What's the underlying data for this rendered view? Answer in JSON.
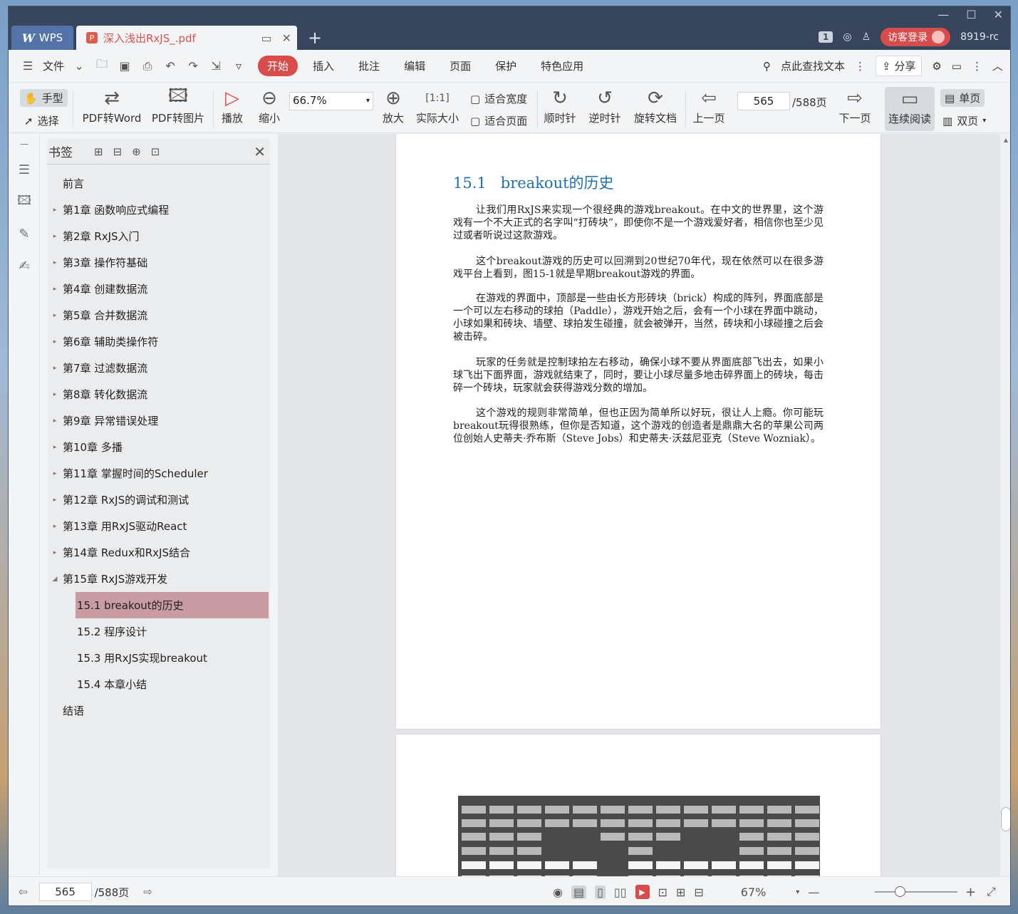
{
  "titlebar": {
    "app_tab": "WPS",
    "doc_tab": "深入浅出RxJS_.pdf",
    "badge": "1",
    "login": "访客登录",
    "user": "8919-rc"
  },
  "menubar": {
    "file": "文件",
    "tabs": [
      "开始",
      "插入",
      "批注",
      "编辑",
      "页面",
      "保护",
      "特色应用"
    ],
    "active_tab": "开始",
    "search": "点此查找文本",
    "share": "分享"
  },
  "toolbar": {
    "hand": "手型",
    "select": "选择",
    "pdf_to_word": "PDF转Word",
    "pdf_to_image": "PDF转图片",
    "play": "播放",
    "zoom_out": "缩小",
    "zoom_value": "66.7%",
    "zoom_in": "放大",
    "actual_size": "实际大小",
    "fit_width": "适合宽度",
    "fit_page": "适合页面",
    "clockwise": "顺时针",
    "counterclockwise": "逆时针",
    "rotate_doc": "旋转文档",
    "prev_page": "上一页",
    "page_value": "565",
    "page_total": "/588页",
    "next_page": "下一页",
    "continuous": "连续阅读",
    "single": "单页",
    "double": "双页"
  },
  "bookmarks": {
    "title": "书签",
    "items": [
      {
        "label": "前言",
        "arrow": ""
      },
      {
        "label": "第1章 函数响应式编程",
        "arrow": "▸"
      },
      {
        "label": "第2章 RxJS入门",
        "arrow": "▸"
      },
      {
        "label": "第3章 操作符基础",
        "arrow": "▸"
      },
      {
        "label": "第4章 创建数据流",
        "arrow": "▸"
      },
      {
        "label": "第5章 合并数据流",
        "arrow": "▸"
      },
      {
        "label": "第6章 辅助类操作符",
        "arrow": "▸"
      },
      {
        "label": "第7章 过滤数据流",
        "arrow": "▸"
      },
      {
        "label": "第8章 转化数据流",
        "arrow": "▸"
      },
      {
        "label": "第9章 异常错误处理",
        "arrow": "▸"
      },
      {
        "label": "第10章 多播",
        "arrow": "▸"
      },
      {
        "label": "第11章 掌握时间的Scheduler",
        "arrow": "▸"
      },
      {
        "label": "第12章 RxJS的调试和测试",
        "arrow": "▸"
      },
      {
        "label": "第13章 用RxJS驱动React",
        "arrow": "▸"
      },
      {
        "label": "第14章 Redux和RxJS结合",
        "arrow": "▸"
      },
      {
        "label": "第15章 RxJS游戏开发",
        "arrow": "◢"
      }
    ],
    "sub_items": [
      {
        "label": "15.1 breakout的历史"
      },
      {
        "label": "15.2 程序设计"
      },
      {
        "label": "15.3 用RxJS实现breakout"
      },
      {
        "label": "15.4 本章小结"
      }
    ],
    "last": "结语"
  },
  "document": {
    "section_num": "15.1",
    "section_title": "breakout的历史",
    "paragraphs": [
      "让我们用RxJS来实现一个很经典的游戏breakout。在中文的世界里，这个游戏有一个不大正式的名字叫“打砖块”，即使你不是一个游戏爱好者，相信你也至少见过或者听说过这款游戏。",
      "这个breakout游戏的历史可以回溯到20世纪70年代，现在依然可以在很多游戏平台上看到，图15-1就是早期breakout游戏的界面。",
      "在游戏的界面中，顶部是一些由长方形砖块（brick）构成的阵列，界面底部是一个可以左右移动的球拍（Paddle），游戏开始之后，会有一个小球在界面中跳动，小球如果和砖块、墙壁、球拍发生碰撞，就会被弹开，当然，砖块和小球碰撞之后会被击碎。",
      "玩家的任务就是控制球拍左右移动，确保小球不要从界面底部飞出去，如果小球飞出下面界面，游戏就结束了，同时，要让小球尽量多地击碎界面上的砖块，每击碎一个砖块，玩家就会获得游戏分数的增加。",
      "这个游戏的规则非常简单，但也正因为简单所以好玩，很让人上瘾。你可能玩breakout玩得很熟练，但你是否知道，这个游戏的创造者是鼎鼎大名的苹果公司两位创始人史蒂夫·乔布斯（Steve Jobs）和史蒂夫·沃兹尼亚克（Steve Wozniak）。"
    ]
  },
  "statusbar": {
    "page_value": "565",
    "page_total": "/588页",
    "zoom": "67%"
  },
  "colors": {
    "accent": "#d94c4c",
    "title_blue": "#1f6fb2",
    "selected_bookmark": "#c99ba2"
  }
}
